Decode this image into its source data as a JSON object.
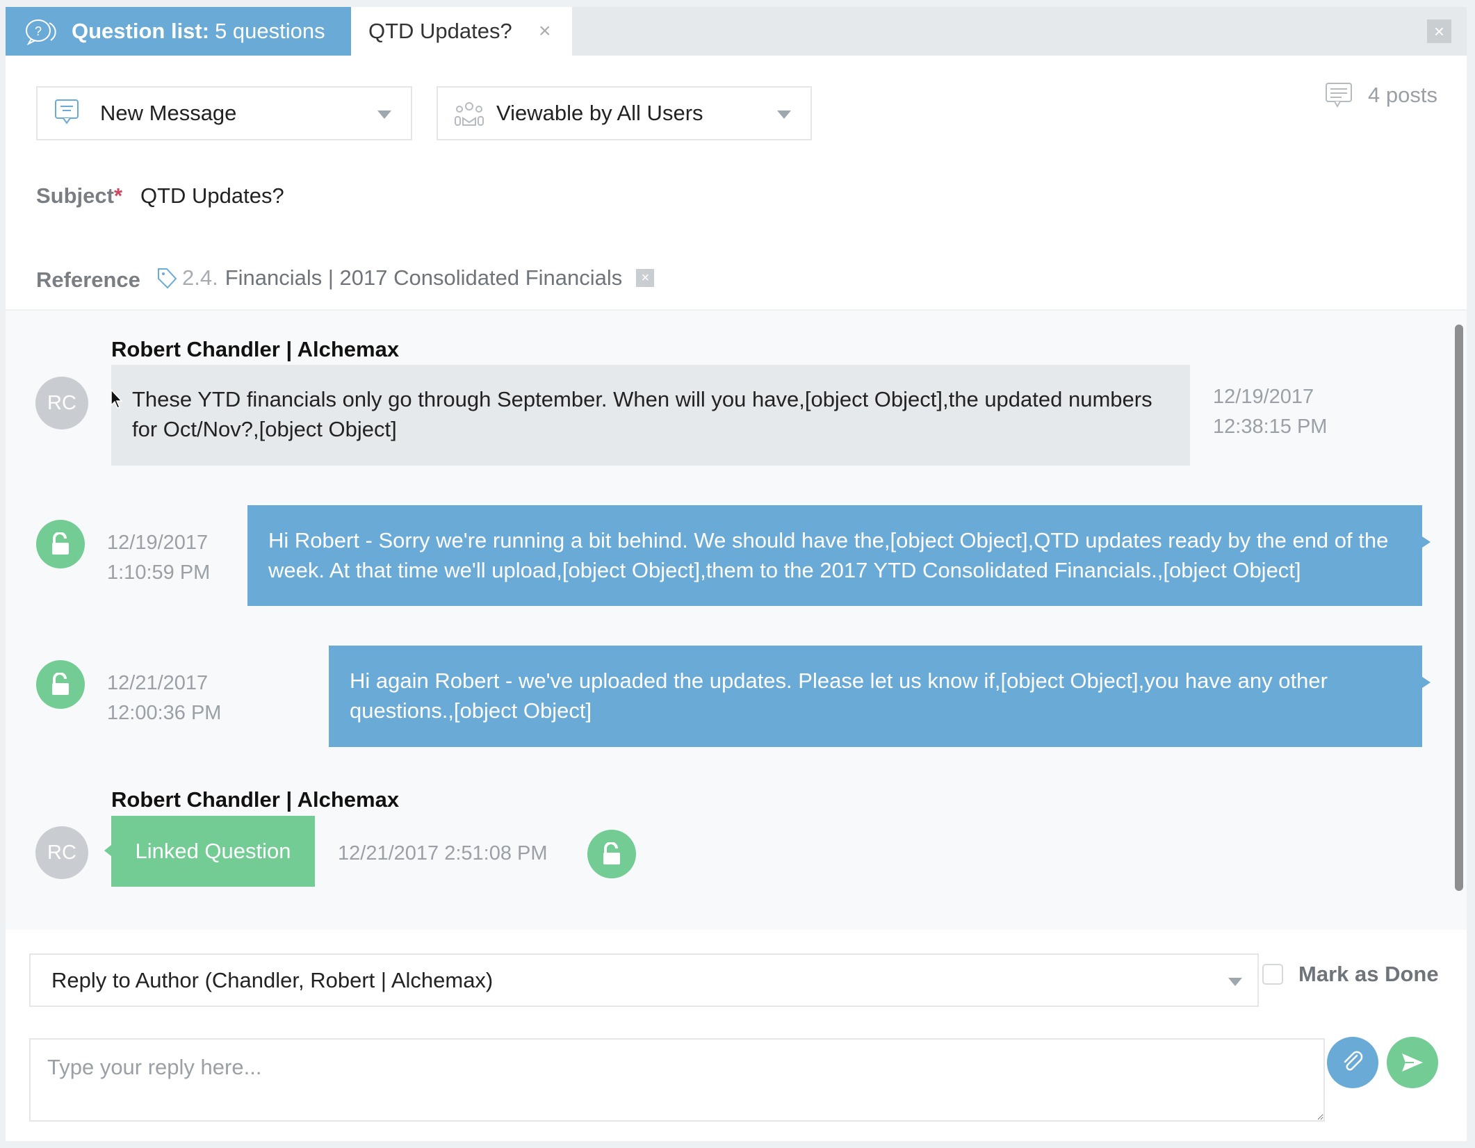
{
  "tabs": {
    "question_list": {
      "label_bold": "Question list:",
      "label_count": "5 questions",
      "icon": "question-bubbles-icon"
    },
    "detail": {
      "label": "QTD Updates?",
      "close": "×"
    },
    "panel_close": "×"
  },
  "header": {
    "message_type": {
      "value": "New Message",
      "icon": "new-message-icon"
    },
    "visibility": {
      "value": "Viewable by All Users",
      "icon": "users-group-icon"
    },
    "posts": {
      "count_label": "4 posts",
      "icon": "comment-icon"
    },
    "subject": {
      "label": "Subject",
      "required_mark": "*",
      "value": "QTD Updates?"
    },
    "reference": {
      "label": "Reference",
      "icon": "tag-icon",
      "number": "2.4.",
      "value": "Financials | 2017 Consolidated Financials",
      "remove": "×"
    }
  },
  "messages": [
    {
      "type": "incoming",
      "author": "Robert Chandler | Alchemax",
      "avatar_initials": "RC",
      "text": "These YTD financials only go through September. When will you have,[object Object],the updated numbers for Oct/Nov?,[object Object]",
      "date": "12/19/2017",
      "time": "12:38:15 PM"
    },
    {
      "type": "outgoing",
      "status_icon": "unlock-icon",
      "date": "12/19/2017",
      "time": "1:10:59 PM",
      "text": "Hi Robert - Sorry we're running a bit behind. We should have the,[object Object],QTD updates ready by the end of the week. At that time we'll upload,[object Object],them to the 2017 YTD Consolidated Financials.,[object Object]"
    },
    {
      "type": "outgoing",
      "status_icon": "unlock-icon",
      "date": "12/21/2017",
      "time": "12:00:36 PM",
      "text": "Hi again Robert - we've uploaded the updates. Please let us know if,[object Object],you have any other questions.,[object Object]"
    },
    {
      "type": "linked",
      "author": "Robert Chandler | Alchemax",
      "avatar_initials": "RC",
      "label": "Linked Question",
      "timestamp": "12/21/2017 2:51:08 PM",
      "status_icon": "unlock-icon"
    }
  ],
  "reply": {
    "recipient": "Reply to Author (Chandler, Robert | Alchemax)",
    "mark_done_label": "Mark as Done",
    "mark_done_checked": false,
    "placeholder": "Type your reply here...",
    "attach_icon": "paperclip-icon",
    "send_icon": "send-icon"
  },
  "colors": {
    "primary_blue": "#6aaad6",
    "success_green": "#72cc93",
    "incoming_bubble": "#e6e9ec",
    "required": "#d0455e"
  }
}
